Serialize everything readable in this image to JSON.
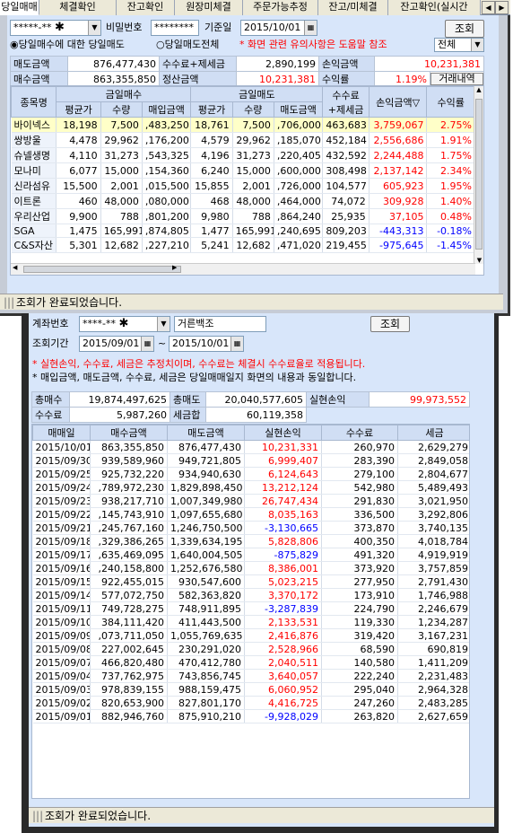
{
  "win1": {
    "tabs": [
      "당일매매",
      "체결확인",
      "잔고확인",
      "원장미체결",
      "주문가능추정",
      "잔고/미체결",
      "잔고확인(실시간"
    ],
    "account_value": "*****-**",
    "password_label": "비밀번호",
    "password_value": "********",
    "date_label": "기준일",
    "date_value": "2015/10/01",
    "query_button": "조회",
    "radio1_label": "당일매수에 대한 당일매도",
    "radio2_label": "당일매도전체",
    "notice": "* 화면 관련 유의사항은 도움말 참조",
    "filter_value": "전체",
    "summary": {
      "buy_amt_label": "매도금액",
      "buy_amt": "876,477,430",
      "fee_tax_label": "수수료+제세금",
      "fee_tax": "2,890,199",
      "pnl_label": "손익금액",
      "pnl": "10,231,381",
      "sell_amt_label": "매수금액",
      "sell_amt": "863,355,850",
      "settle_label": "정산금액",
      "settle": "10,231,381",
      "yield_label": "수익률",
      "yield": "1.19%",
      "history_button": "거래내역"
    },
    "table": {
      "h_name": "종목명",
      "h_buy": "금일매수",
      "h_sell": "금일매도",
      "h_avg": "평균가",
      "h_qty": "수량",
      "h_buy_amt": "매입금액",
      "h_sell_amt": "매도금액",
      "h_fee": "수수료\n+제세금",
      "h_fee1": "수수료",
      "h_fee2": "+제세금",
      "h_pnl": "손익금액▽",
      "h_yield": "수익률",
      "rows": [
        {
          "name": "바이넥스",
          "ba": "18,198",
          "bq": "7,500",
          "bamt": ",483,250",
          "sa": "18,761",
          "sq": "7,500",
          "samt": ",706,000",
          "fee": "463,683",
          "pnl": "3,759,067",
          "yld": "2.75%",
          "neg": false,
          "sel": true
        },
        {
          "name": "쌍방울",
          "ba": "4,478",
          "bq": "29,962",
          "bamt": ",176,200",
          "sa": "4,579",
          "sq": "29,962",
          "samt": ",185,070",
          "fee": "452,184",
          "pnl": "2,556,686",
          "yld": "1.91%",
          "neg": false,
          "sel": false
        },
        {
          "name": "슈넬생명",
          "ba": "4,110",
          "bq": "31,273",
          "bamt": ",543,325",
          "sa": "4,196",
          "sq": "31,273",
          "samt": ",220,405",
          "fee": "432,592",
          "pnl": "2,244,488",
          "yld": "1.75%",
          "neg": false,
          "sel": false
        },
        {
          "name": "모나미",
          "ba": "6,077",
          "bq": "15,000",
          "bamt": ",154,360",
          "sa": "6,240",
          "sq": "15,000",
          "samt": ",600,000",
          "fee": "308,498",
          "pnl": "2,137,142",
          "yld": "2.34%",
          "neg": false,
          "sel": false
        },
        {
          "name": "신라섬유",
          "ba": "15,500",
          "bq": "2,001",
          "bamt": ",015,500",
          "sa": "15,855",
          "sq": "2,001",
          "samt": ",726,000",
          "fee": "104,577",
          "pnl": "605,923",
          "yld": "1.95%",
          "neg": false,
          "sel": false
        },
        {
          "name": "이트론",
          "ba": "460",
          "bq": "48,000",
          "bamt": ",080,000",
          "sa": "468",
          "sq": "48,000",
          "samt": ",464,000",
          "fee": "74,072",
          "pnl": "309,928",
          "yld": "1.40%",
          "neg": false,
          "sel": false
        },
        {
          "name": "우리산업",
          "ba": "9,900",
          "bq": "788",
          "bamt": ",801,200",
          "sa": "9,980",
          "sq": "788",
          "samt": ",864,240",
          "fee": "25,935",
          "pnl": "37,105",
          "yld": "0.48%",
          "neg": false,
          "sel": false
        },
        {
          "name": "SGA",
          "ba": "1,475",
          "bq": "165,991",
          "bamt": ",874,805",
          "sa": "1,477",
          "sq": "165,991",
          "samt": ",240,695",
          "fee": "809,203",
          "pnl": "-443,313",
          "yld": "-0.18%",
          "neg": true,
          "sel": false
        },
        {
          "name": "C&S자산",
          "ba": "5,301",
          "bq": "12,682",
          "bamt": ",227,210",
          "sa": "5,241",
          "sq": "12,682",
          "samt": ",471,020",
          "fee": "219,455",
          "pnl": "-975,645",
          "yld": "-1.45%",
          "neg": true,
          "sel": false
        }
      ]
    },
    "status": "조회가 완료되었습니다."
  },
  "win2": {
    "account_label": "계좌번호",
    "account_value": "****-**",
    "account_name": "거른백조",
    "query_button": "조회",
    "period_label": "조회기간",
    "date_from": "2015/09/01",
    "date_sep": "~",
    "date_to": "2015/10/01",
    "note1": "* 실현손익, 수수료, 세금은 추정치이며, 수수료는 체결시 수수료율로 적용됩니다.",
    "note2": "* 매입금액, 매도금액, 수수료, 세금은 당일매매일지 화면의 내용과 동일합니다.",
    "summary": {
      "total_buy_label": "총매수",
      "total_buy": "19,874,497,625",
      "total_sell_label": "총매도",
      "total_sell": "20,040,577,605",
      "realized_label": "실현손익",
      "realized": "99,973,552",
      "fee_label": "수수료",
      "fee": "5,987,260",
      "tax_label": "세금합",
      "tax": "60,119,358"
    },
    "table": {
      "headers": [
        "매매일",
        "매수금액",
        "매도금액",
        "실현손익",
        "수수료",
        "세금"
      ],
      "rows": [
        {
          "date": "2015/10/01",
          "buy": "863,355,850",
          "sell": "876,477,430",
          "pnl": "10,231,331",
          "fee": "260,970",
          "tax": "2,629,279",
          "neg": false
        },
        {
          "date": "2015/09/30",
          "buy": "939,589,960",
          "sell": "949,721,805",
          "pnl": "6,999,407",
          "fee": "283,390",
          "tax": "2,849,058",
          "neg": false
        },
        {
          "date": "2015/09/25",
          "buy": "925,732,220",
          "sell": "934,940,630",
          "pnl": "6,124,643",
          "fee": "279,100",
          "tax": "2,804,677",
          "neg": false
        },
        {
          "date": "2015/09/24",
          "buy": ",789,972,230",
          "sell": "1,829,898,450",
          "pnl": "13,212,124",
          "fee": "542,980",
          "tax": "5,489,493",
          "neg": false
        },
        {
          "date": "2015/09/23",
          "buy": "938,217,710",
          "sell": "1,007,349,980",
          "pnl": "26,747,434",
          "fee": "291,830",
          "tax": "3,021,950",
          "neg": false
        },
        {
          "date": "2015/09/22",
          "buy": ",145,743,910",
          "sell": "1,097,655,680",
          "pnl": "8,035,163",
          "fee": "336,500",
          "tax": "3,292,806",
          "neg": false
        },
        {
          "date": "2015/09/21",
          "buy": ",245,767,160",
          "sell": "1,246,750,500",
          "pnl": "-3,130,665",
          "fee": "373,870",
          "tax": "3,740,135",
          "neg": true
        },
        {
          "date": "2015/09/18",
          "buy": ",329,386,265",
          "sell": "1,339,634,195",
          "pnl": "5,828,806",
          "fee": "400,350",
          "tax": "4,018,784",
          "neg": false
        },
        {
          "date": "2015/09/17",
          "buy": ",635,469,095",
          "sell": "1,640,004,505",
          "pnl": "-875,829",
          "fee": "491,320",
          "tax": "4,919,919",
          "neg": true
        },
        {
          "date": "2015/09/16",
          "buy": ",240,158,800",
          "sell": "1,252,676,580",
          "pnl": "8,386,001",
          "fee": "373,920",
          "tax": "3,757,859",
          "neg": false
        },
        {
          "date": "2015/09/15",
          "buy": "922,455,015",
          "sell": "930,547,600",
          "pnl": "5,023,215",
          "fee": "277,950",
          "tax": "2,791,430",
          "neg": false
        },
        {
          "date": "2015/09/14",
          "buy": "577,072,750",
          "sell": "582,363,820",
          "pnl": "3,370,172",
          "fee": "173,910",
          "tax": "1,746,988",
          "neg": false
        },
        {
          "date": "2015/09/11",
          "buy": "749,728,275",
          "sell": "748,911,895",
          "pnl": "-3,287,839",
          "fee": "224,790",
          "tax": "2,246,679",
          "neg": true
        },
        {
          "date": "2015/09/10",
          "buy": "384,111,420",
          "sell": "411,443,500",
          "pnl": "2,133,531",
          "fee": "119,330",
          "tax": "1,234,287",
          "neg": false
        },
        {
          "date": "2015/09/09",
          "buy": ",073,711,050",
          "sell": "1,055,769,635",
          "pnl": "2,416,876",
          "fee": "319,420",
          "tax": "3,167,231",
          "neg": false
        },
        {
          "date": "2015/09/08",
          "buy": "227,002,645",
          "sell": "230,291,020",
          "pnl": "2,528,966",
          "fee": "68,590",
          "tax": "690,819",
          "neg": false
        },
        {
          "date": "2015/09/07",
          "buy": "466,820,480",
          "sell": "470,412,780",
          "pnl": "2,040,511",
          "fee": "140,580",
          "tax": "1,411,209",
          "neg": false
        },
        {
          "date": "2015/09/04",
          "buy": "737,762,975",
          "sell": "743,856,745",
          "pnl": "3,640,057",
          "fee": "222,240",
          "tax": "2,231,483",
          "neg": false
        },
        {
          "date": "2015/09/03",
          "buy": "978,839,155",
          "sell": "988,159,475",
          "pnl": "6,060,952",
          "fee": "295,040",
          "tax": "2,964,328",
          "neg": false
        },
        {
          "date": "2015/09/02",
          "buy": "820,653,900",
          "sell": "827,801,170",
          "pnl": "4,416,725",
          "fee": "247,260",
          "tax": "2,483,285",
          "neg": false
        },
        {
          "date": "2015/09/01",
          "buy": "882,946,760",
          "sell": "875,910,210",
          "pnl": "-9,928,029",
          "fee": "263,820",
          "tax": "2,627,659",
          "neg": true
        }
      ]
    },
    "status": "조회가 완료되었습니다."
  },
  "colors": {
    "panel_bg": "#d8e6fa",
    "header_bg": "#d0def4",
    "positive": "#ff0000",
    "negative": "#0000ff",
    "selected_row": "#ffffc8"
  }
}
